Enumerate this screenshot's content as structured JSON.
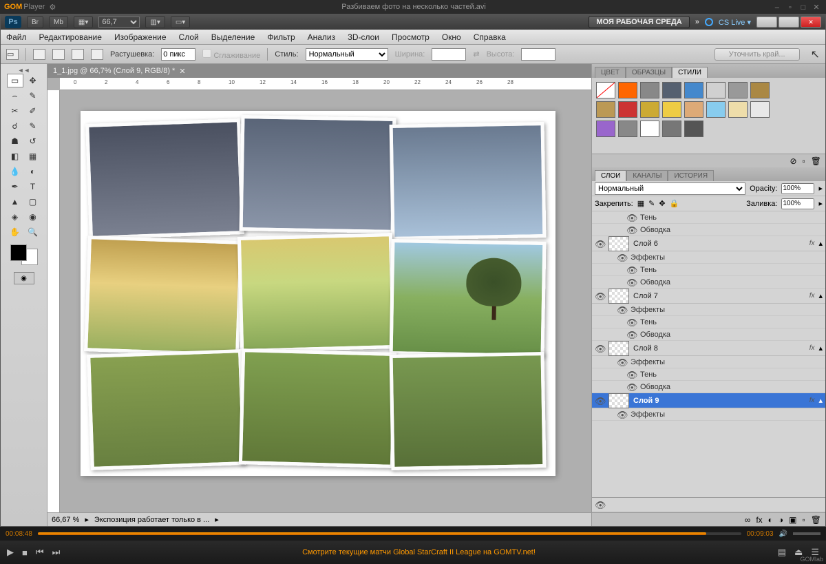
{
  "gom": {
    "brand": "GOM",
    "brand2": "Player",
    "title": "Разбиваем фото на несколько частей.avi",
    "time_current": "00:08:48",
    "time_total": "00:09:03",
    "message": "Смотрите текущие матчи Global StarCraft II League на GOMTV.net!",
    "lab": "GOMlab"
  },
  "ps": {
    "zoom": "66,7",
    "workspace_btn": "МОЯ РАБОЧАЯ СРЕДА",
    "cslive": "CS Live",
    "br_btn": "Br",
    "mb_btn": "Mb",
    "menu": [
      "Файл",
      "Редактирование",
      "Изображение",
      "Слой",
      "Выделение",
      "Фильтр",
      "Анализ",
      "3D-слои",
      "Просмотр",
      "Окно",
      "Справка"
    ],
    "options": {
      "feather_label": "Растушевка:",
      "feather_value": "0 пикс",
      "antialias": "Сглаживание",
      "style_label": "Стиль:",
      "style_value": "Нормальный",
      "width_label": "Ширина:",
      "height_label": "Высота:",
      "refine": "Уточнить край..."
    },
    "doc_tab": "1_1.jpg @ 66,7% (Слой 9, RGB/8) *",
    "ruler_ticks": [
      "0",
      "2",
      "4",
      "6",
      "8",
      "10",
      "12",
      "14",
      "16",
      "18",
      "20",
      "22",
      "24",
      "26",
      "28"
    ],
    "status_zoom": "66,67 %",
    "status_info": "Экспозиция работает только в ...",
    "panels": {
      "color_tabs": [
        "ЦВЕТ",
        "ОБРАЗЦЫ",
        "СТИЛИ"
      ],
      "layer_tabs": [
        "СЛОИ",
        "КАНАЛЫ",
        "ИСТОРИЯ"
      ],
      "blend_mode": "Нормальный",
      "opacity_label": "Opacity:",
      "opacity_value": "100%",
      "lock_label": "Закрепить:",
      "fill_label": "Заливка:",
      "fill_value": "100%",
      "sub_effects": "Эффекты",
      "sub_shadow": "Тень",
      "sub_stroke": "Обводка",
      "fx": "fx",
      "layers": [
        {
          "name": "Слой 6"
        },
        {
          "name": "Слой 7"
        },
        {
          "name": "Слой 8"
        },
        {
          "name": "Слой 9",
          "selected": true
        }
      ],
      "style_colors": [
        "#ff6600",
        "#888888",
        "#556070",
        "#4488cc",
        "#d0d0d0",
        "#999999",
        "#aa8844",
        "#bb9955",
        "#cc3333",
        "#ccaa33",
        "#eecc44",
        "#ddaa77",
        "#88ccee",
        "#eeddaa",
        "#e8e8e8",
        "#9966cc",
        "#888888",
        "#ffffff",
        "#777777",
        "#555555"
      ]
    }
  }
}
